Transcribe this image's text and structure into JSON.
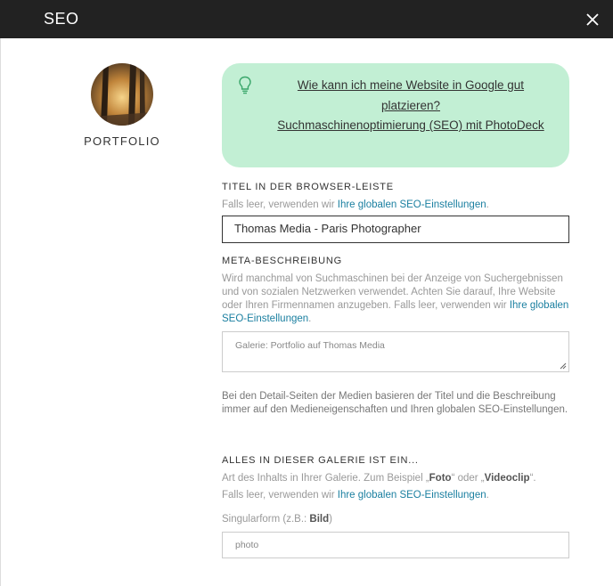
{
  "window": {
    "title": "SEO"
  },
  "sidebar": {
    "name": "PORTFOLIO"
  },
  "tip": {
    "link1": "Wie kann ich meine Website in Google gut platzieren?",
    "link2": "Suchmaschinenoptimierung (SEO) mit PhotoDeck"
  },
  "browser_title": {
    "label": "TITEL IN DER BROWSER-LEISTE",
    "help_prefix": "Falls leer, verwenden wir ",
    "help_link": "Ihre globalen SEO-Einstellungen",
    "help_suffix": ".",
    "value": "Thomas Media - Paris Photographer"
  },
  "meta": {
    "label": "META-BESCHREIBUNG",
    "help_prefix": "Wird manchmal von Suchmaschinen bei der Anzeige von Suchergebnissen und von sozialen Netzwerken verwendet. Achten Sie darauf, Ihre Website oder Ihren Firmennamen anzugeben. Falls leer, verwenden wir ",
    "help_link": "Ihre globalen SEO-Einstellungen",
    "help_suffix": ".",
    "placeholder": "Galerie:  Portfolio auf Thomas Media"
  },
  "detail_note": "Bei den Detail-Seiten der Medien basieren der Titel und die Beschreibung immer auf den Medieneigenschaften und Ihren globalen SEO-Einstellungen.",
  "gallery": {
    "label": "ALLES IN DIESER GALERIE IST EIN...",
    "help_a": "Art des Inhalts in Ihrer Galerie. Zum Beispiel „",
    "help_b": "Foto",
    "help_c": "“ oder „",
    "help_d": "Videoclip",
    "help_e": "“.",
    "help2_prefix": "Falls leer, verwenden wir ",
    "help2_link": "Ihre globalen SEO-Einstellungen",
    "help2_suffix": ".",
    "singular_prefix": "Singularform (z.B.: ",
    "singular_bold": "Bild",
    "singular_suffix": ")",
    "singular_placeholder": "photo"
  }
}
